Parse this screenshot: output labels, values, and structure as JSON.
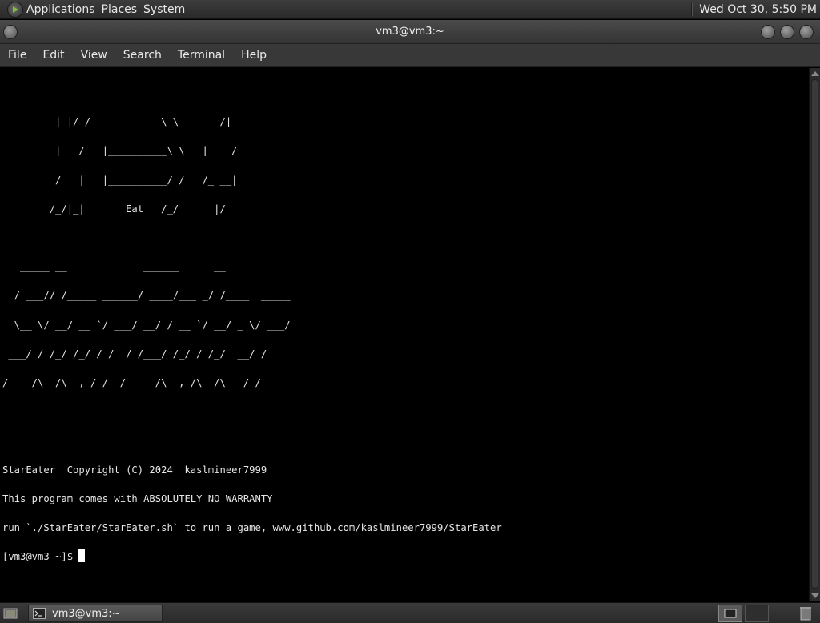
{
  "top_panel": {
    "menus": [
      "Applications",
      "Places",
      "System"
    ],
    "clock": "Wed Oct 30,  5:50 PM"
  },
  "window": {
    "title": "vm3@vm3:~"
  },
  "menubar": {
    "items": [
      "File",
      "Edit",
      "View",
      "Search",
      "Terminal",
      "Help"
    ]
  },
  "terminal": {
    "lines": [
      "          _ __            __",
      "         | |/ /   _________\\ \\     __/|_",
      "         |   /   |__________\\ \\   |    /",
      "         /   |   |__________/ /   /_ __|",
      "        /_/|_|       Eat   /_/      |/",
      "",
      "   _____ __             ______      __",
      "  / ___// /_____ ______/ ____/___ _/ /____  _____",
      "  \\__ \\/ __/ __ `/ ___/ __/ / __ `/ __/ _ \\/ ___/",
      " ___/ / /_/ /_/ / /  / /___/ /_/ / /_/  __/ /",
      "/____/\\__/\\__,_/_/  /_____/\\__,_/\\__/\\___/_/",
      "",
      "",
      "StarEater  Copyright (C) 2024  kaslmineer7999",
      "This program comes with ABSOLUTELY NO WARRANTY",
      "run `./StarEater/StarEater.sh` to run a game, www.github.com/kaslmineer7999/StarEater"
    ],
    "prompt": "[vm3@vm3 ~]$ "
  },
  "bottom_panel": {
    "task_label": "vm3@vm3:~"
  },
  "colors": {
    "panel_bg": "#2f2f2f",
    "terminal_bg": "#000000",
    "terminal_fg": "#e6e6e6"
  }
}
